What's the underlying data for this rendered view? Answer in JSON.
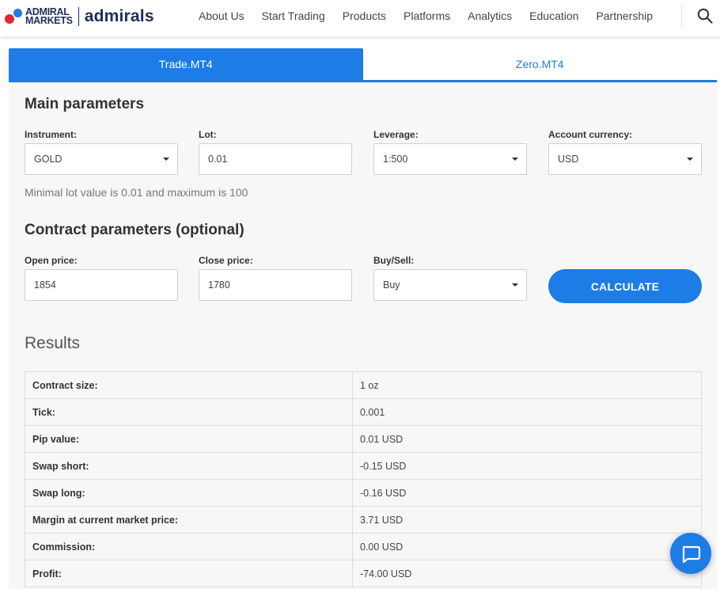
{
  "header": {
    "logo_line1": "ADMIRAL",
    "logo_line2": "MARKETS",
    "logo_brand": "admirals",
    "nav": [
      "About Us",
      "Start Trading",
      "Products",
      "Platforms",
      "Analytics",
      "Education",
      "Partnership"
    ]
  },
  "tabs": [
    {
      "label": "Trade.MT4",
      "active": true
    },
    {
      "label": "Zero.MT4",
      "active": false
    }
  ],
  "main": {
    "title": "Main parameters",
    "fields": [
      {
        "label": "Instrument:",
        "value": "GOLD",
        "type": "select"
      },
      {
        "label": "Lot:",
        "value": "0.01",
        "type": "input"
      },
      {
        "label": "Leverage:",
        "value": "1:500",
        "type": "select"
      },
      {
        "label": "Account currency:",
        "value": "USD",
        "type": "select"
      }
    ],
    "hint": "Minimal lot value is 0.01 and maximum is 100"
  },
  "contract": {
    "title": "Contract parameters (optional)",
    "fields": [
      {
        "label": "Open price:",
        "value": "1854",
        "type": "input"
      },
      {
        "label": "Close price:",
        "value": "1780",
        "type": "input"
      },
      {
        "label": "Buy/Sell:",
        "value": "Buy",
        "type": "select"
      }
    ],
    "calculate_label": "CALCULATE"
  },
  "results": {
    "title": "Results",
    "rows": [
      {
        "label": "Contract size:",
        "value": "1 oz"
      },
      {
        "label": "Tick:",
        "value": "0.001"
      },
      {
        "label": "Pip value:",
        "value": "0.01 USD"
      },
      {
        "label": "Swap short:",
        "value": "-0.15 USD"
      },
      {
        "label": "Swap long:",
        "value": "-0.16 USD"
      },
      {
        "label": "Margin at current market price:",
        "value": "3.71 USD"
      },
      {
        "label": "Commission:",
        "value": "0.00 USD"
      },
      {
        "label": "Profit:",
        "value": "-74.00 USD"
      }
    ]
  },
  "icons": {
    "search": "search-icon",
    "chat": "chat-icon",
    "caret": "chevron-down-icon"
  },
  "colors": {
    "accent": "#1d7ce6",
    "logo_red": "#e4262d",
    "logo_navy": "#1f2d5c"
  }
}
